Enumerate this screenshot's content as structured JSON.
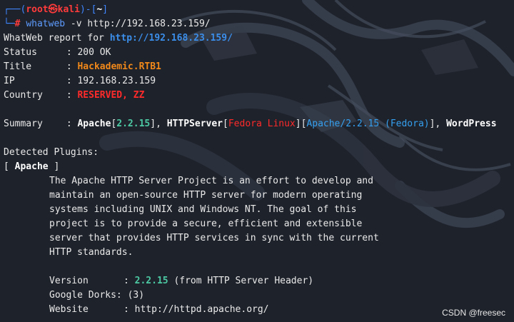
{
  "prompt": {
    "open": "┌──(",
    "user": "root㉿kali",
    "mid": ")-[",
    "dir": "~",
    "close": "]",
    "second": "└─",
    "symbol": "# ",
    "command_name": "whatweb",
    "command_args": " -v http://192.168.23.159/"
  },
  "report": {
    "header_text": "WhatWeb report for ",
    "url": "http://192.168.23.159/",
    "fields": [
      {
        "label": "Status",
        "sep": " : ",
        "value": "200 OK"
      },
      {
        "label": "Title",
        "sep": " : ",
        "value": "Hackademic.RTB1"
      },
      {
        "label": "IP",
        "sep": " : ",
        "value": "192.168.23.159"
      },
      {
        "label": "Country",
        "sep": " : ",
        "value": "RESERVED, ZZ"
      }
    ],
    "summary": {
      "label": "Summary",
      "sep": " : ",
      "apache": "Apache",
      "apache_version": "2.2.15",
      "httpserver": "HTTPServer",
      "os": "Fedora Linux",
      "server_string": "Apache/2.2.15 (Fedora)",
      "wordpress": "WordPress"
    }
  },
  "plugins": {
    "heading": "Detected Plugins:",
    "plugin_name": "Apache",
    "description": [
      "The Apache HTTP Server Project is an effort to develop and",
      "maintain an open-source HTTP server for modern operating",
      "systems including UNIX and Windows NT. The goal of this",
      "project is to provide a secure, efficient and extensible",
      "server that provides HTTP services in sync with the current",
      "HTTP standards."
    ],
    "details": {
      "version_label": "Version",
      "version_value": "2.2.15",
      "version_note": " (from HTTP Server Header)",
      "dorks_label": "Google Dorks:",
      "dorks_value": " (3)",
      "website_label": "Website",
      "website_value": "http://httpd.apache.org/"
    }
  },
  "watermark": "CSDN @freesec",
  "colors": {
    "background": "#1e222b",
    "prompt_frame": "#3f86ff",
    "user_red": "#ff3b3b",
    "url_blue": "#3b8eea",
    "version_green": "#4cc9a3",
    "title_orange": "#f0881a"
  }
}
